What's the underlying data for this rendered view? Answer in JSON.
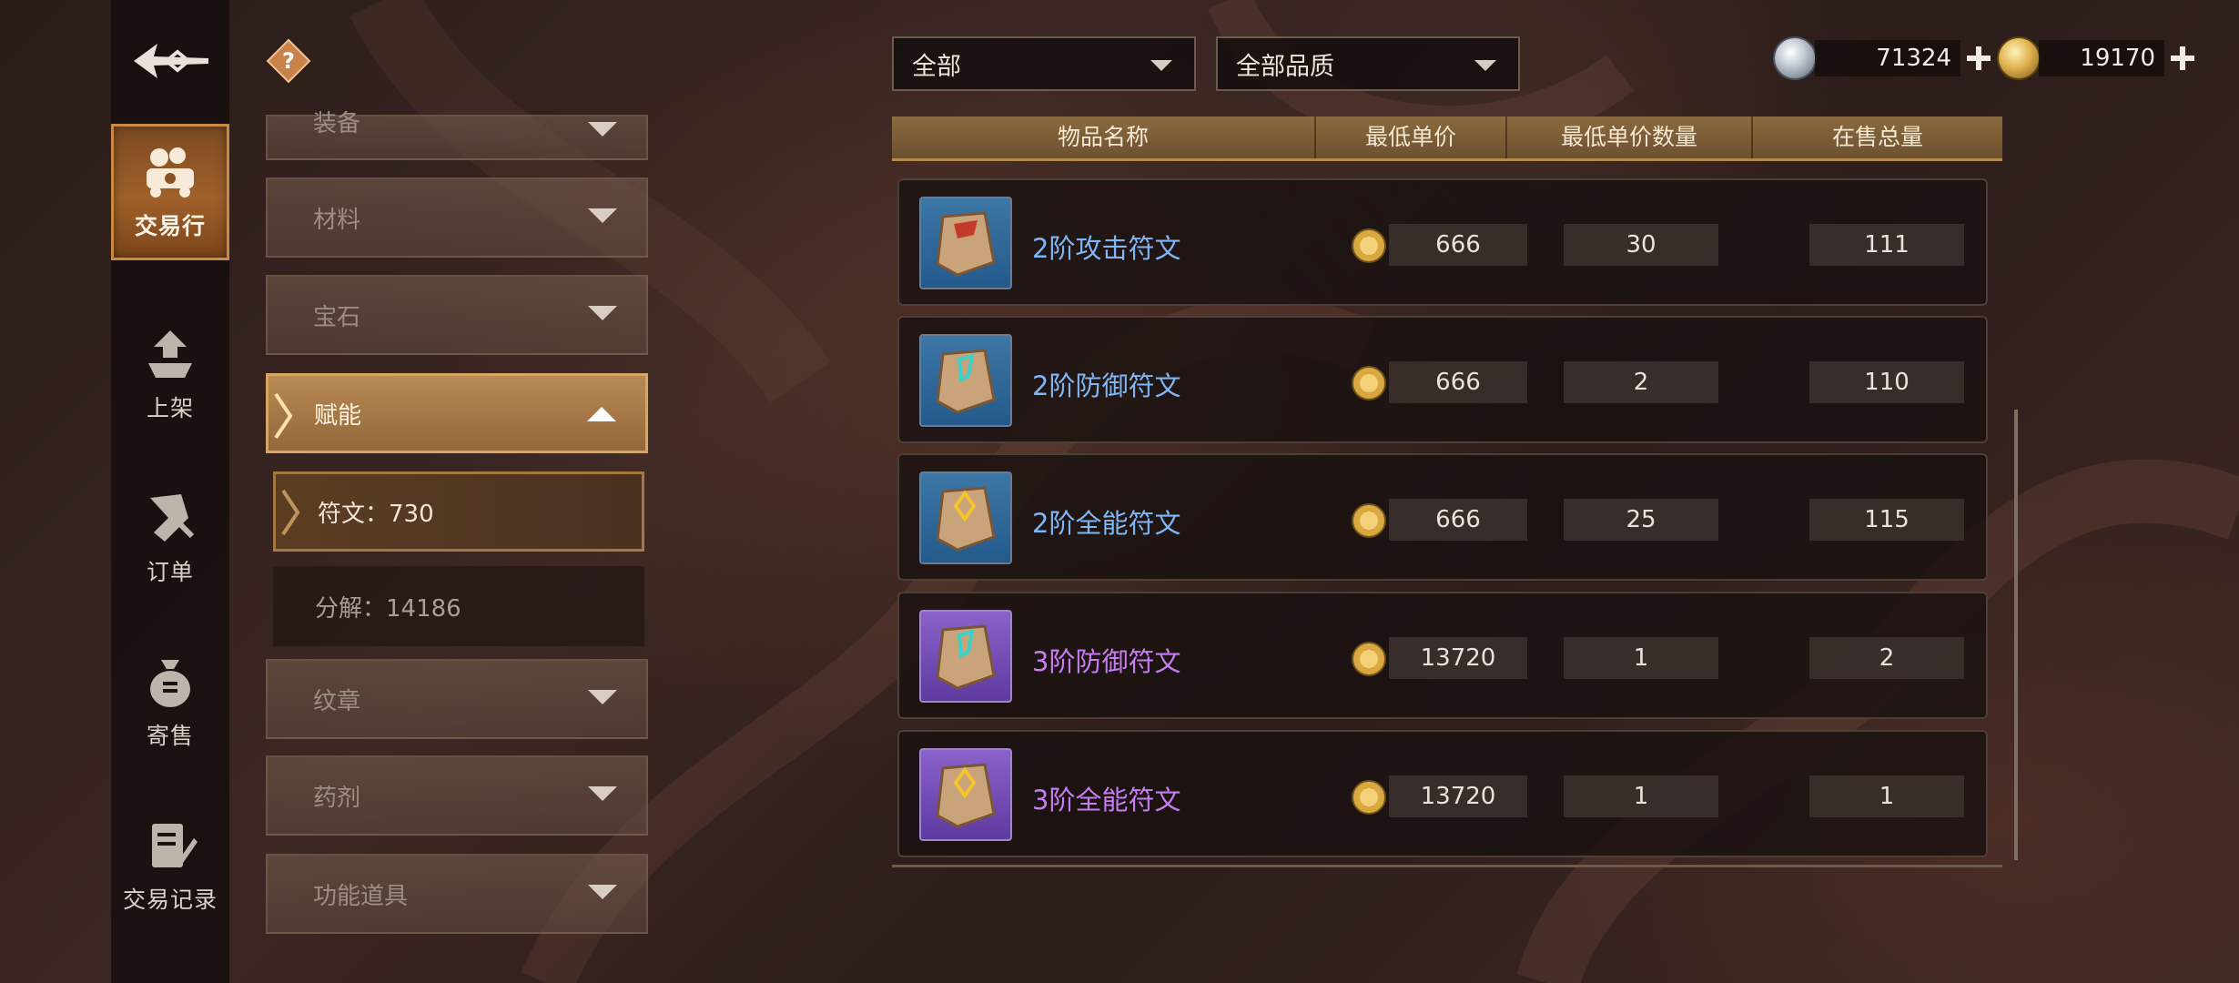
{
  "nav": {
    "items": [
      {
        "label": "交易行",
        "icon": "auction-house-icon",
        "active": true
      },
      {
        "label": "上架",
        "icon": "list-item-icon",
        "active": false
      },
      {
        "label": "订单",
        "icon": "order-icon",
        "active": false
      },
      {
        "label": "寄售",
        "icon": "consignment-bag-icon",
        "active": false
      },
      {
        "label": "交易记录",
        "icon": "trade-record-icon",
        "active": false
      }
    ]
  },
  "categories": {
    "items": [
      {
        "label": "装备"
      },
      {
        "label": "材料"
      },
      {
        "label": "宝石"
      },
      {
        "label": "赋能",
        "expanded": true
      },
      {
        "label": "纹章"
      },
      {
        "label": "药剂"
      },
      {
        "label": "功能道具"
      }
    ],
    "sub_items": [
      {
        "label": "符文：730",
        "selected": true
      },
      {
        "label": "分解：14186",
        "selected": false
      }
    ]
  },
  "filters": {
    "type": {
      "value": "全部"
    },
    "quality": {
      "value": "全部品质"
    }
  },
  "currency": {
    "silver": {
      "amount": "71324",
      "icon": "silver-coin-icon"
    },
    "gold": {
      "amount": "19170",
      "icon": "gold-coin-icon"
    }
  },
  "table": {
    "headers": [
      "物品名称",
      "最低单价",
      "最低单价数量",
      "在售总量"
    ],
    "rows": [
      {
        "name": "2阶攻击符文",
        "rarity": "blue",
        "rune": "attack",
        "price": "666",
        "qty": "30",
        "total": "111"
      },
      {
        "name": "2阶防御符文",
        "rarity": "blue",
        "rune": "defense",
        "price": "666",
        "qty": "2",
        "total": "110"
      },
      {
        "name": "2阶全能符文",
        "rarity": "blue",
        "rune": "allround",
        "price": "666",
        "qty": "25",
        "total": "115"
      },
      {
        "name": "3阶防御符文",
        "rarity": "purple",
        "rune": "defense",
        "price": "13720",
        "qty": "1",
        "total": "2"
      },
      {
        "name": "3阶全能符文",
        "rarity": "purple",
        "rune": "allround",
        "price": "13720",
        "qty": "1",
        "total": "1"
      }
    ]
  },
  "colors": {
    "rarity_blue": "#7fb6f5",
    "rarity_purple": "#c67cf2",
    "accent_gold": "#d9a565"
  }
}
